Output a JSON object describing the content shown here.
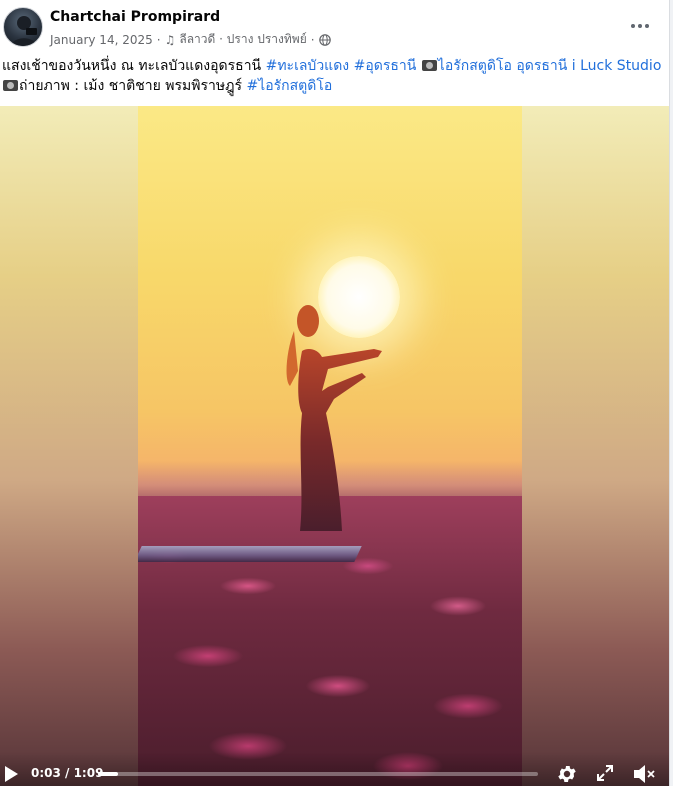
{
  "post": {
    "author": "Chartchai Prompirard",
    "date": "January 14, 2025",
    "separator": "·",
    "music_note": "♫",
    "audio_label": "ลีลาวดี · ปราง ปรางทิพย์",
    "privacy_icon": "globe-icon",
    "more_icon": "more-options-icon"
  },
  "caption": {
    "text_1": "แสงเช้าของวันหนึ่ง ณ ทะเลบัวแดงอุดรธานี ",
    "tag_1": "#ทะเลบัวแดง",
    "space_1": " ",
    "tag_2": "#อุดรธานี",
    "space_2": "  ",
    "link_1": "ไอรักสตูดิโอ อุดรธานี i Luck Studio",
    "text_2": "ถ่ายภาพ : เม้ง ชาติชาย พรมพิราษฎูร์ ",
    "tag_3": "#ไอรักสตูดิโอ"
  },
  "video": {
    "time_display": "0:03 / 1:09",
    "progress": 0.045,
    "play_icon": "play-icon",
    "settings_icon": "gear-icon",
    "fullscreen_icon": "fullscreen-icon",
    "mute_icon": "muted-speaker-icon"
  }
}
